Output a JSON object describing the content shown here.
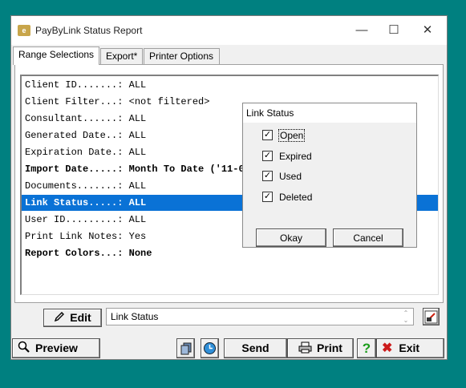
{
  "window": {
    "title": "PayByLink Status Report",
    "icon_text": "e",
    "controls": {
      "minimize": "—",
      "maximize": "☐",
      "close": "✕"
    }
  },
  "tabs": [
    {
      "label": "Range Selections",
      "active": true
    },
    {
      "label": "Export*",
      "active": false
    },
    {
      "label": "Printer Options",
      "active": false
    }
  ],
  "selections": [
    {
      "text": "Client ID.......: ALL",
      "bold": false,
      "selected": false
    },
    {
      "text": "Client Filter...: <not filtered>",
      "bold": false,
      "selected": false
    },
    {
      "text": "Consultant......: ALL",
      "bold": false,
      "selected": false
    },
    {
      "text": "Generated Date..: ALL",
      "bold": false,
      "selected": false
    },
    {
      "text": "Expiration Date.: ALL",
      "bold": false,
      "selected": false
    },
    {
      "text": "Import Date.....: Month To Date ('11-01-",
      "bold": true,
      "selected": false
    },
    {
      "text": "Documents.......: ALL",
      "bold": false,
      "selected": false
    },
    {
      "text": "Link Status.....: ALL",
      "bold": true,
      "selected": true
    },
    {
      "text": "User ID.........: ALL",
      "bold": false,
      "selected": false
    },
    {
      "text": "Print Link Notes: Yes",
      "bold": false,
      "selected": false
    },
    {
      "text": "Report Colors...: None",
      "bold": true,
      "selected": false
    }
  ],
  "popup": {
    "title": "Link Status",
    "options": [
      {
        "label": "Open",
        "checked": true
      },
      {
        "label": "Expired",
        "checked": true
      },
      {
        "label": "Used",
        "checked": true
      },
      {
        "label": "Deleted",
        "checked": true
      }
    ],
    "ok_label": "Okay",
    "cancel_label": "Cancel"
  },
  "editbar": {
    "edit_label": "Edit",
    "field_value": "Link Status"
  },
  "bottombar": {
    "preview_label": "Preview",
    "send_label": "Send",
    "print_label": "Print",
    "help_label": "?",
    "exit_label": "Exit"
  },
  "colors": {
    "desktop": "#008080",
    "selection": "#0a72d6",
    "help_green": "#1a9c1a",
    "exit_red": "#cc1b1b"
  }
}
